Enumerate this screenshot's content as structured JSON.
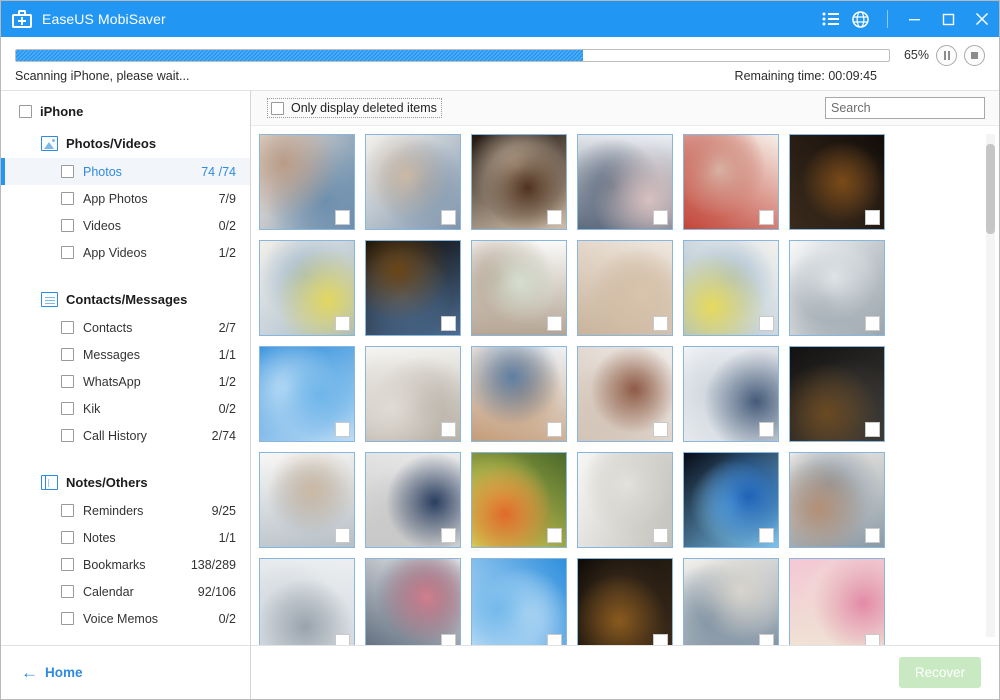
{
  "window": {
    "app_icon": "first-aid-kit-icon",
    "title": "EaseUS MobiSaver",
    "menu_icon": "list-menu-icon",
    "globe_icon": "globe-icon",
    "minimize_label": "—",
    "maximize_label": "☐",
    "close_label": "✕",
    "accent_color": "#2196f3"
  },
  "progress": {
    "percent_label": "65%",
    "percent_value": 65,
    "pause_icon": "pause-icon",
    "stop_icon": "stop-icon",
    "status_text": "Scanning iPhone, please wait...",
    "remaining_text": "Remaining time: 00:09:45"
  },
  "sidebar": {
    "root": {
      "label": "iPhone",
      "checked": false
    },
    "groups": [
      {
        "label": "Photos/Videos",
        "icon": "photo-group-icon",
        "items": [
          {
            "label": "Photos",
            "count": "74 /74",
            "selected": true
          },
          {
            "label": "App Photos",
            "count": "7/9",
            "selected": false
          },
          {
            "label": "Videos",
            "count": "0/2",
            "selected": false
          },
          {
            "label": "App Videos",
            "count": "1/2",
            "selected": false
          }
        ]
      },
      {
        "label": "Contacts/Messages",
        "icon": "contacts-group-icon",
        "items": [
          {
            "label": "Contacts",
            "count": "2/7",
            "selected": false
          },
          {
            "label": "Messages",
            "count": "1/1",
            "selected": false
          },
          {
            "label": "WhatsApp",
            "count": "1/2",
            "selected": false
          },
          {
            "label": "Kik",
            "count": "0/2",
            "selected": false
          },
          {
            "label": "Call History",
            "count": "2/74",
            "selected": false
          }
        ]
      },
      {
        "label": "Notes/Others",
        "icon": "notes-group-icon",
        "items": [
          {
            "label": "Reminders",
            "count": "9/25",
            "selected": false
          },
          {
            "label": "Notes",
            "count": "1/1",
            "selected": false
          },
          {
            "label": "Bookmarks",
            "count": "138/289",
            "selected": false
          },
          {
            "label": "Calendar",
            "count": "92/106",
            "selected": false
          },
          {
            "label": "Voice Memos",
            "count": "0/2",
            "selected": false
          }
        ]
      }
    ],
    "home_link": {
      "arrow": "←",
      "label": "Home"
    }
  },
  "main": {
    "filter_checkbox": {
      "label": "Only display deleted items",
      "checked": false
    },
    "search": {
      "value": "",
      "placeholder": "Search"
    },
    "recover_button": {
      "label": "Recover",
      "enabled": false,
      "color": "#c8e9c1"
    },
    "thumbnails": [
      {
        "alt": "family at laptop in kitchen",
        "c1": "#f0e4da",
        "c2": "#b99b86",
        "c3": "#6d8fae"
      },
      {
        "alt": "two women in bright studio",
        "c1": "#f4f1ec",
        "c2": "#cbb9a6",
        "c3": "#7f95ad"
      },
      {
        "alt": "woman at laptop at night",
        "c1": "#20150f",
        "c2": "#50331f",
        "c3": "#cfbda8"
      },
      {
        "alt": "man working at desk blurred",
        "c1": "#eceef2",
        "c2": "#d8c0bf",
        "c3": "#5d6a7d"
      },
      {
        "alt": "girl opening gift with mother",
        "c1": "#f6efe8",
        "c2": "#d8b2a4",
        "c3": "#c24437"
      },
      {
        "alt": "woman with tablet dark room",
        "c1": "#120d09",
        "c2": "#7a4a18",
        "c3": "#3a2a1c"
      },
      {
        "alt": "two women with yellow tulips",
        "c1": "#f2efe9",
        "c2": "#e3d75f",
        "c3": "#9fb7cb"
      },
      {
        "alt": "man at bar at night",
        "c1": "#0b0906",
        "c2": "#6b4516",
        "c3": "#4c6c91"
      },
      {
        "alt": "white living room with plant",
        "c1": "#fbfbfa",
        "c2": "#d5ded0",
        "c3": "#b4a493"
      },
      {
        "alt": "empty wood table bokeh",
        "c1": "#efe7df",
        "c2": "#d9c4ad",
        "c3": "#c9b39b"
      },
      {
        "alt": "woman holding yellow flowers",
        "c1": "#f2f2ee",
        "c2": "#e5d95c",
        "c3": "#a7bdd0"
      },
      {
        "alt": "man at laptop near shelves",
        "c1": "#f7f8f8",
        "c2": "#dfe3e6",
        "c3": "#9aa5ad"
      },
      {
        "alt": "blue sky with clouds",
        "c1": "#2d8ddb",
        "c2": "#6fb6ea",
        "c3": "#bcdcf5"
      },
      {
        "alt": "white dining room interior",
        "c1": "#f6f5f2",
        "c2": "#e0dcd5",
        "c3": "#b9b2a8"
      },
      {
        "alt": "man writing beside laptop",
        "c1": "#eef1f4",
        "c2": "#5f7fa3",
        "c3": "#c49c78"
      },
      {
        "alt": "team meeting at brick office",
        "c1": "#f0ece8",
        "c2": "#8e5a45",
        "c3": "#d2c3b6"
      },
      {
        "alt": "businessman at desk smiling",
        "c1": "#f3f4f6",
        "c2": "#445a79",
        "c3": "#cfd6dd"
      },
      {
        "alt": "city skyline at dusk window",
        "c1": "#131212",
        "c2": "#6b4a22",
        "c3": "#3d3a36"
      },
      {
        "alt": "woman at white desk",
        "c1": "#f8f7f5",
        "c2": "#cbb9a4",
        "c3": "#b6bfc7"
      },
      {
        "alt": "team reviewing plans",
        "c1": "#e9e9e9",
        "c2": "#2a3e60",
        "c3": "#c7c7c7"
      },
      {
        "alt": "woman with rainbow umbrella",
        "c1": "#4c6a2a",
        "c2": "#e06a2a",
        "c3": "#d8d35a"
      },
      {
        "alt": "bright empty loft interior",
        "c1": "#f7f7f5",
        "c2": "#e3e2dd",
        "c3": "#c2c0ba"
      },
      {
        "alt": "blue earth globe in space",
        "c1": "#060b18",
        "c2": "#1f63b8",
        "c3": "#79c3f0"
      },
      {
        "alt": "couple on sofa with laptop",
        "c1": "#efe9e4",
        "c2": "#b38f76",
        "c3": "#8a9aa6"
      },
      {
        "alt": "conference dining hall",
        "c1": "#eceef0",
        "c2": "#9aa3ad",
        "c3": "#cfd6dc"
      },
      {
        "alt": "man in library blurred",
        "c1": "#f0f0f2",
        "c2": "#d27f8e",
        "c3": "#5d6b7c"
      },
      {
        "alt": "blue sky clouds",
        "c1": "#2f8fdd",
        "c2": "#74b9ec",
        "c3": "#c3e1f6"
      },
      {
        "alt": "candles at evening window",
        "c1": "#100c08",
        "c2": "#8a5a1e",
        "c3": "#3c2c1c"
      },
      {
        "alt": "couple with balloons",
        "c1": "#f4f1ec",
        "c2": "#d8d4cd",
        "c3": "#7c8fa0"
      },
      {
        "alt": "pink roses valentine card",
        "c1": "#f4c7d4",
        "c2": "#e38aa8",
        "c3": "#efe4d4"
      }
    ]
  }
}
